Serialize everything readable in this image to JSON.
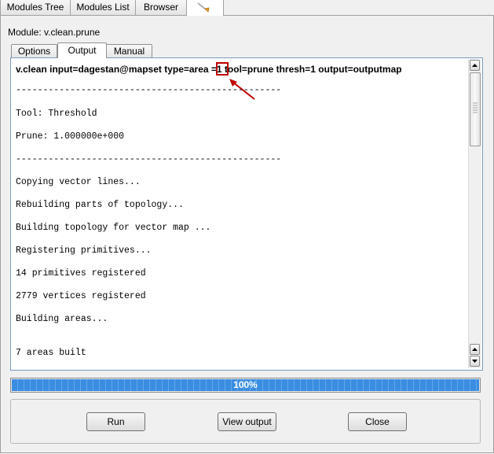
{
  "top_tabs": [
    {
      "label": "Modules Tree"
    },
    {
      "label": "Modules List"
    },
    {
      "label": "Browser"
    }
  ],
  "module": {
    "label": "Module: v.clean.prune"
  },
  "inner_tabs": [
    {
      "label": "Options"
    },
    {
      "label": "Output"
    },
    {
      "label": "Manual"
    }
  ],
  "output": {
    "command": "v.clean input=dagestan@mapset type=area =1 tool=prune thresh=1 output=outputmap",
    "lines": [
      "-------------------------------------------------",
      "Tool: Threshold",
      "Prune: 1.000000e+000",
      "-------------------------------------------------",
      "Copying vector lines...",
      "Rebuilding parts of topology...",
      "Building topology for vector map ...",
      "Registering primitives...",
      "14 primitives registered",
      "2779 vertices registered",
      "Building areas...",
      "7 areas built"
    ]
  },
  "progress": {
    "value": 1.0,
    "text": "100%"
  },
  "buttons": {
    "run": "Run",
    "view_output": "View output",
    "close": "Close"
  },
  "colors": {
    "progress": "#3a8de0",
    "highlight": "#c00000",
    "frame_border": "#7a9cbc"
  }
}
